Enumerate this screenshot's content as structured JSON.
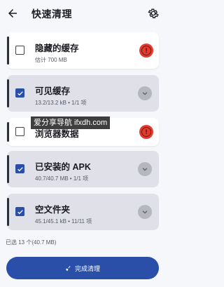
{
  "header": {
    "title": "快速清理"
  },
  "items": [
    {
      "name": "隐藏的缓存",
      "sub": "估计 700 MB",
      "checked": false,
      "action": "warning"
    },
    {
      "name": "可见缓存",
      "sub": "13.2/13.2 kB • 1/1 项",
      "checked": true,
      "action": "expand"
    },
    {
      "name": "浏览器数据",
      "sub": "",
      "checked": false,
      "action": "warning"
    },
    {
      "name": "已安装的 APK",
      "sub": "40.7/40.7 MB • 1/1 项",
      "checked": true,
      "action": "expand"
    },
    {
      "name": "空文件夹",
      "sub": "45.1/45.1 kB • 11/11 项",
      "checked": true,
      "action": "expand"
    }
  ],
  "watermark": "爱分享导航 ifxdh.com",
  "summary": "已选 13 个(40.7 MB)",
  "primary_button": "完成清理",
  "colors": {
    "accent": "#2a4fa8",
    "warning": "#e23b2e",
    "selected_card": "#dfe0e8"
  }
}
